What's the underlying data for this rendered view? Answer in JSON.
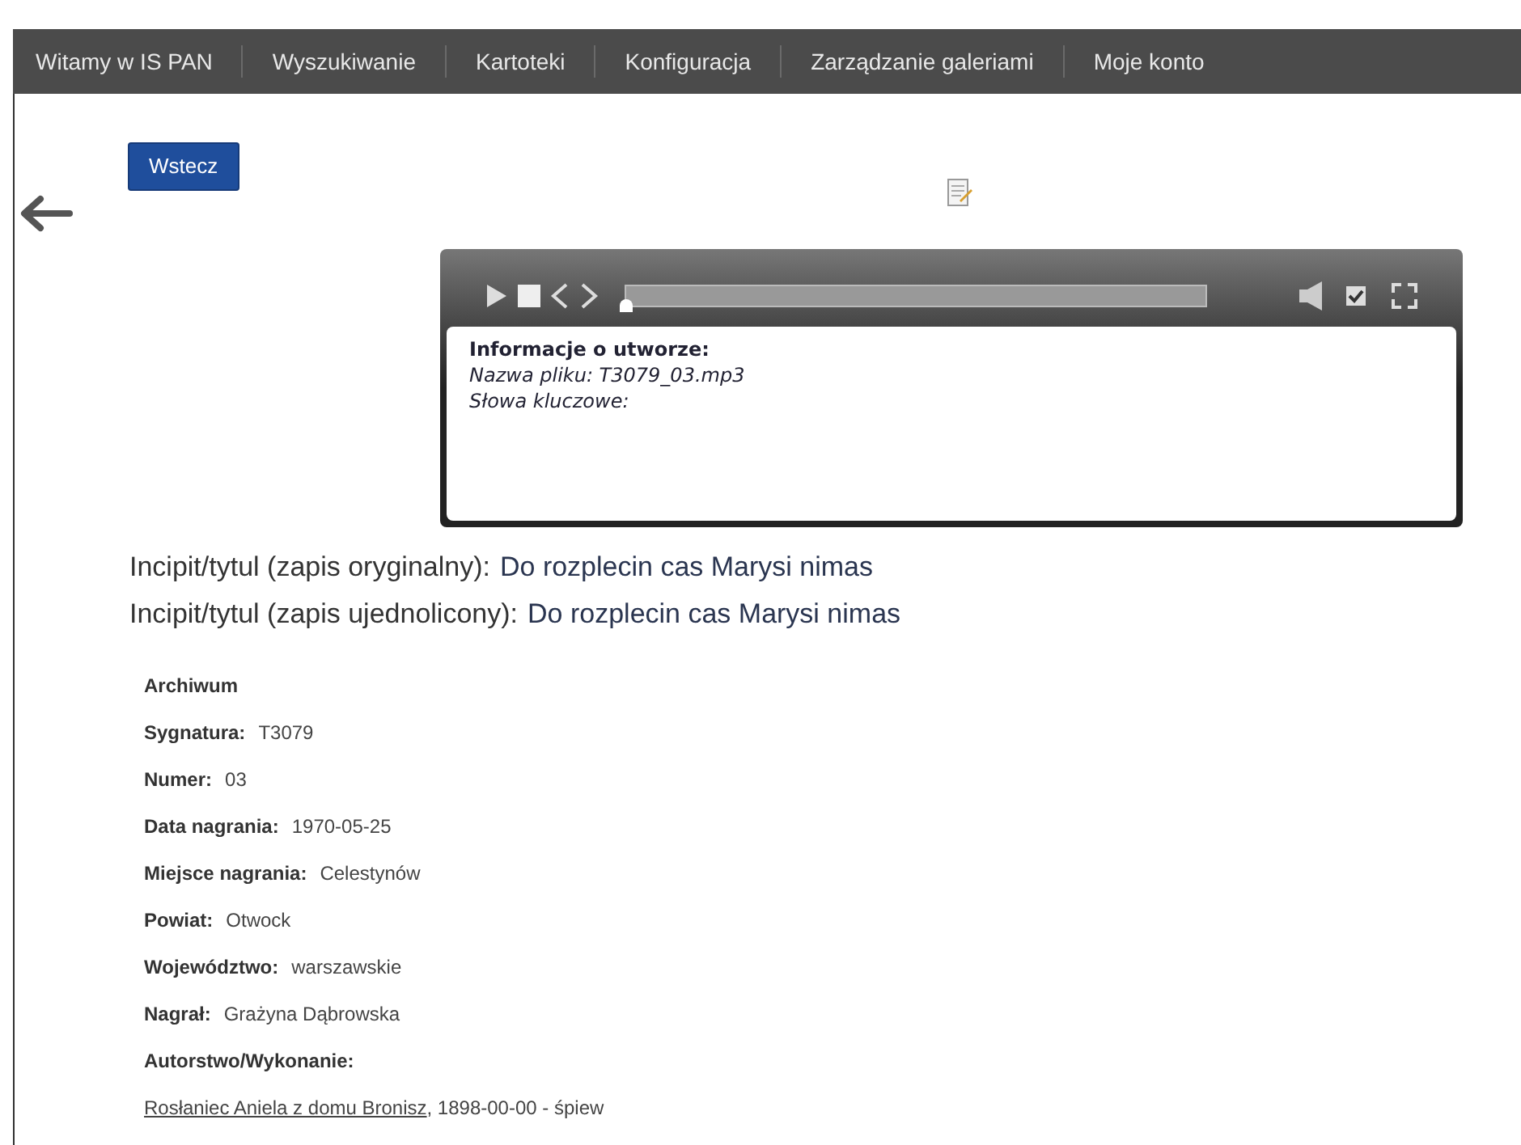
{
  "nav": [
    {
      "label": "Witamy w IS PAN"
    },
    {
      "label": "Wyszukiwanie"
    },
    {
      "label": "Kartoteki"
    },
    {
      "label": "Konfiguracja"
    },
    {
      "label": "Zarządzanie galeriami"
    },
    {
      "label": "Moje konto"
    }
  ],
  "back_button": "Wstecz",
  "player": {
    "level": 0,
    "info_title": "Informacje o utworze:",
    "lines": [
      "Nazwa pliku: T3079_03.mp3",
      "Słowa kluczowe:"
    ]
  },
  "titles": [
    {
      "label": "Incipit/tytul (zapis oryginalny):",
      "value": "Do rozplecin cas Marysi nimas"
    },
    {
      "label": "Incipit/tytul (zapis ujednolicony):",
      "value": "Do rozplecin cas Marysi nimas"
    }
  ],
  "fields": [
    {
      "label": "Archiwum"
    },
    {
      "label": "Sygnatura:",
      "value": "T3079"
    },
    {
      "label": "Numer:",
      "value": "03"
    },
    {
      "label": "Data nagrania:",
      "value": "1970-05-25"
    },
    {
      "label": "Miejsce nagrania:",
      "value": "Celestynów"
    },
    {
      "label": "Powiat:",
      "value": "Otwock"
    },
    {
      "label": "Województwo:",
      "value": "warszawskie"
    },
    {
      "label": "Nagrał:",
      "value": "Grażyna Dąbrowska"
    },
    {
      "label": "Autorstwo/Wykonanie:"
    }
  ],
  "author": {
    "link": "Rosłaniec Aniela z domu Bronisz",
    "rest": ", 1898-00-00 - śpiew"
  }
}
